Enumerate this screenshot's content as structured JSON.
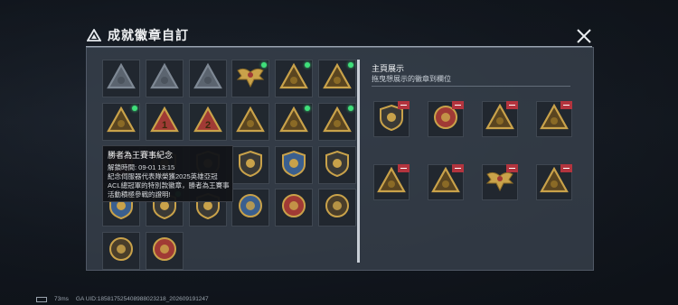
{
  "window": {
    "title": "成就徽章自訂",
    "close_icon": "close-icon"
  },
  "colors": {
    "panel": "#3a424e",
    "gold": "#c9a24a",
    "new_dot": "#3fe07a",
    "remove": "#b3343e"
  },
  "badge_grid": {
    "items": [
      {
        "icon": "triangle-emblem-gray",
        "new": false
      },
      {
        "icon": "triangle-eagle-gray",
        "new": false
      },
      {
        "icon": "triangle-wings-gray",
        "new": false
      },
      {
        "icon": "eagle-crest-gold",
        "new": true
      },
      {
        "icon": "triangle-eagle-gold",
        "new": true
      },
      {
        "icon": "triangle-laurel-gold",
        "new": true
      },
      {
        "icon": "triangle-star-gold",
        "new": true
      },
      {
        "icon": "triangle-rank-1",
        "new": false
      },
      {
        "icon": "triangle-rank-2",
        "new": false
      },
      {
        "icon": "triangle-trophy-gold",
        "new": false
      },
      {
        "icon": "triangle-crown-gold",
        "new": true
      },
      {
        "icon": "triangle-fortress-gold",
        "new": true
      },
      {
        "icon": "shield-red-gold",
        "new": false
      },
      {
        "icon": "shield-star-gold",
        "new": false
      },
      {
        "icon": "shield-lion-gold",
        "new": false
      },
      {
        "icon": "shield-laurel-gold",
        "new": false
      },
      {
        "icon": "shield-wings-blue",
        "new": false
      },
      {
        "icon": "shield-laurel-gold",
        "new": false
      },
      {
        "icon": "shield-wings-blue",
        "new": false
      },
      {
        "icon": "shield-star-laurel",
        "new": true
      },
      {
        "icon": "shield-sword-gold",
        "new": false
      },
      {
        "icon": "round-wing-blue",
        "new": false
      },
      {
        "icon": "round-horse-red",
        "new": false
      },
      {
        "icon": "round-ball-gold",
        "new": false
      },
      {
        "icon": "round-lion-gold",
        "new": false
      },
      {
        "icon": "round-sword-red",
        "new": false
      }
    ]
  },
  "tooltip": {
    "title": "勝者為王賽事紀念",
    "unlock_time": "解鎖時間: 09-01 13:15",
    "desc_line1": "紀念伺服器代表隊榮獲2025英雄亞冠",
    "desc_line2": "ACL總冠軍的特別款徽章，勝者為王賽事",
    "desc_line3": "活動積極參戰的證明!"
  },
  "showcase": {
    "title": "主頁展示",
    "subtitle": "拖曳想展示的徽章到欄位",
    "slots": [
      {
        "icon": "shield-star-laurel"
      },
      {
        "icon": "round-star-red"
      },
      {
        "icon": "triangle-star-gold"
      },
      {
        "icon": "triangle-fortress-gold"
      },
      {
        "icon": "triangle-laurel-gold"
      },
      {
        "icon": "triangle-eagle-gold"
      },
      {
        "icon": "eagle-crest-gold"
      },
      {
        "icon": "triangle-trophy-gold"
      }
    ]
  },
  "footer": {
    "ping": "73ms",
    "uid": "GA UID:185817525408988023218_202609191247"
  }
}
